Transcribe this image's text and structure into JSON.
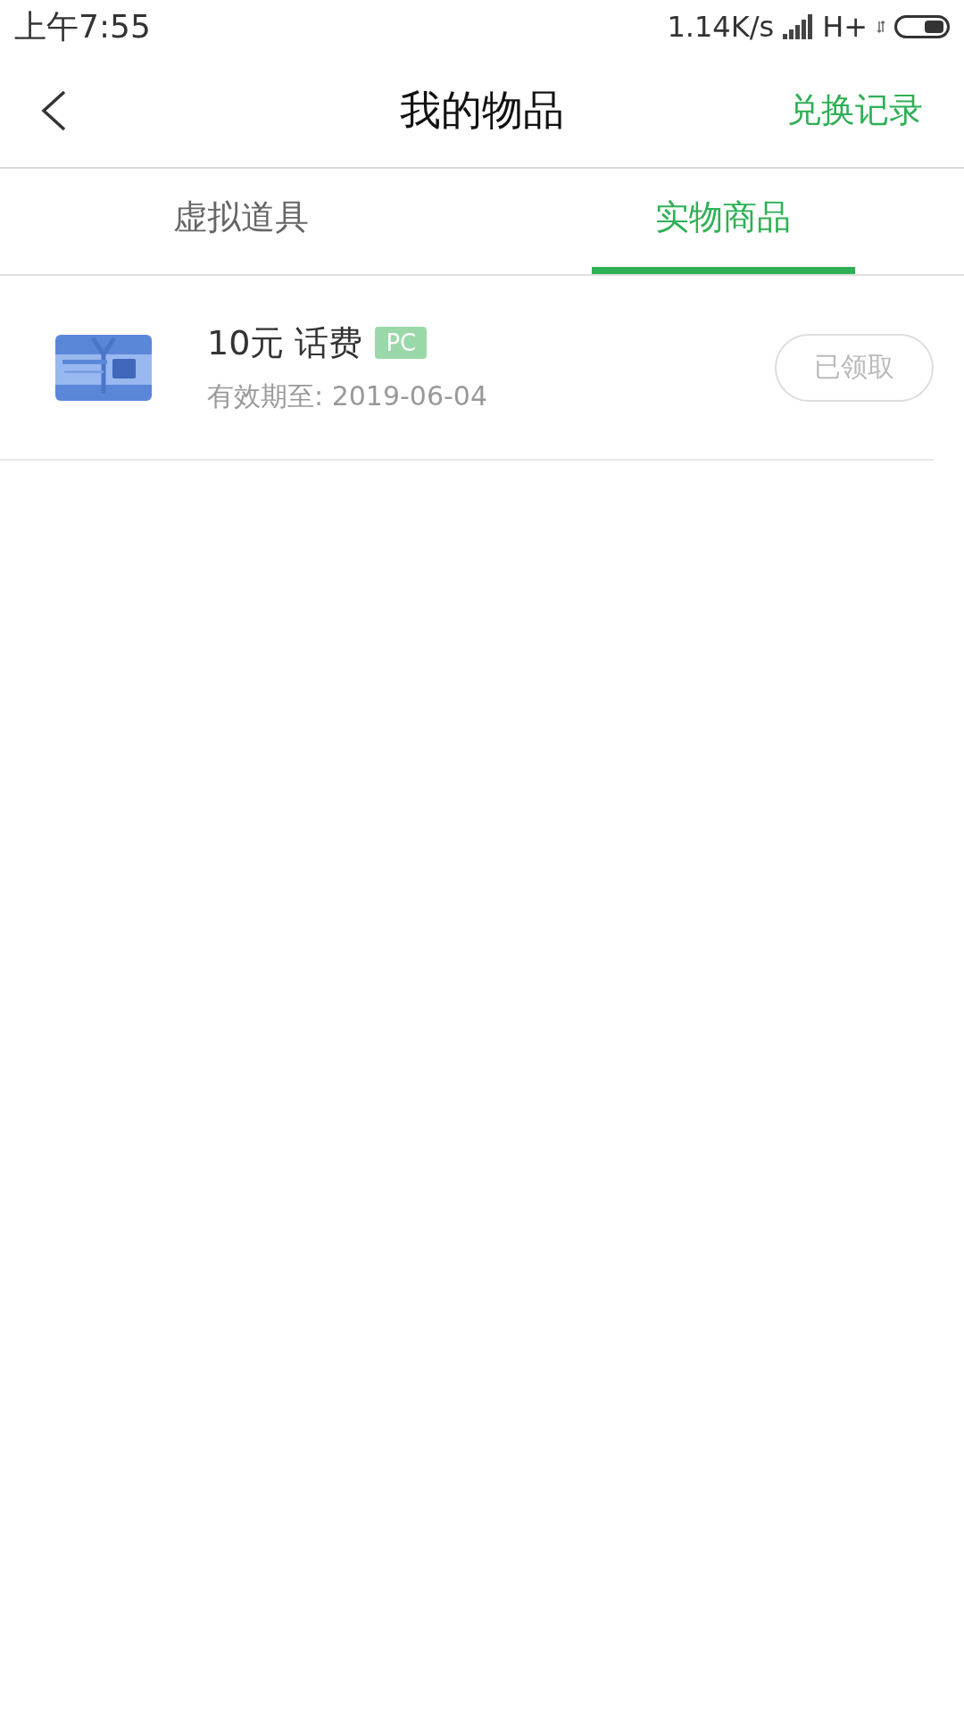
{
  "status_bar": {
    "time": "上午7:55",
    "speed": "1.14K/s",
    "network": "H+"
  },
  "header": {
    "title": "我的物品",
    "action": "兑换记录"
  },
  "tabs": [
    {
      "label": "虚拟道具",
      "selected": false
    },
    {
      "label": "实物商品",
      "selected": true
    }
  ],
  "items": [
    {
      "name": "10元 话费",
      "badge": "PC",
      "validity": "有效期至: 2019-06-04",
      "button": "已领取",
      "disabled": true
    }
  ]
}
